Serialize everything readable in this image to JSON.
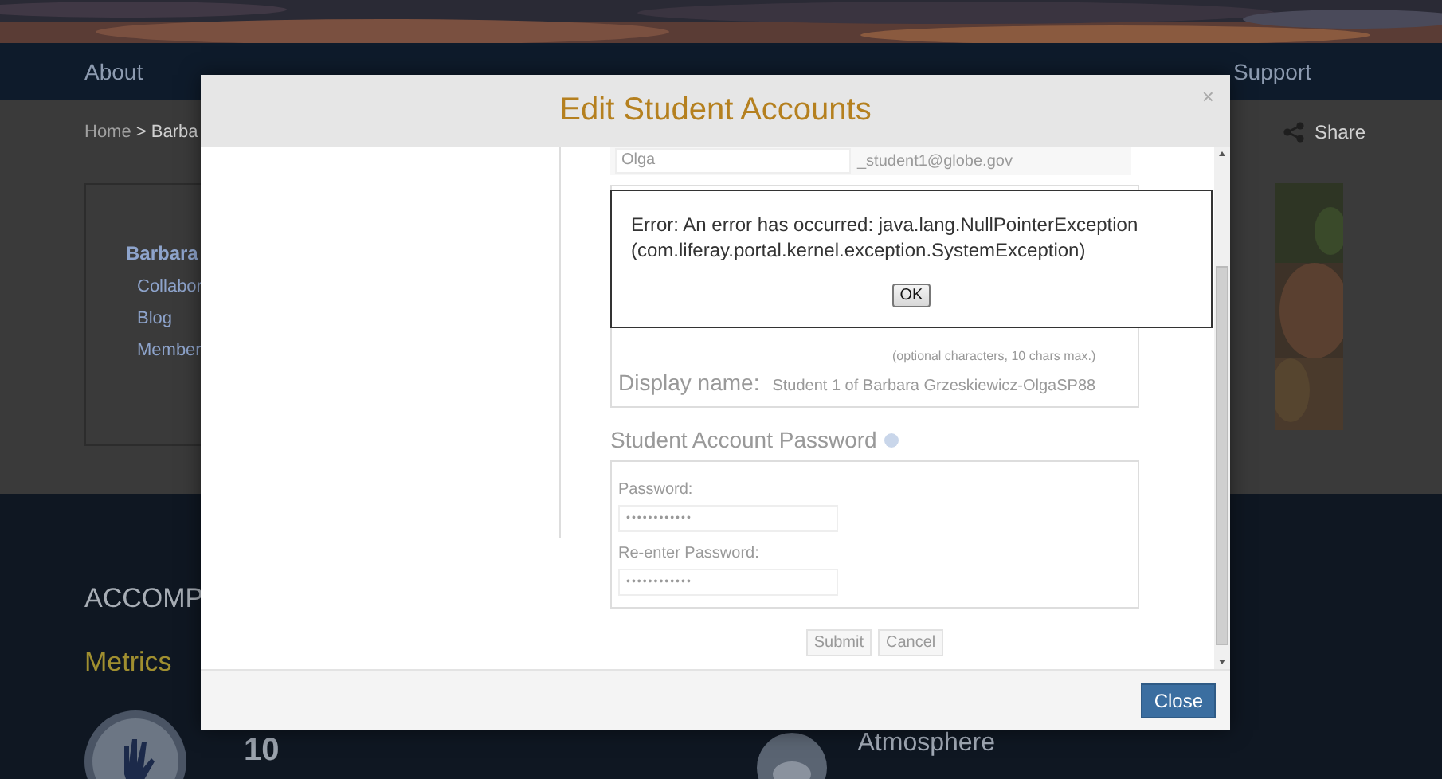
{
  "nav": {
    "items": [
      "About",
      "Support"
    ]
  },
  "breadcrumb": {
    "home": "Home",
    "separator": ">",
    "current": "Barba"
  },
  "share": {
    "label": "Share"
  },
  "sidebar": {
    "title": "Barbara",
    "links": [
      "Collabor",
      "Blog",
      "Member"
    ]
  },
  "accomplishments": {
    "heading": "ACCOMP",
    "metrics_heading": "Metrics",
    "count": "10",
    "category": "Atmosphere"
  },
  "modal": {
    "title": "Edit Student Accounts",
    "close": "×",
    "first_row": {
      "first_name": "Olga",
      "email": "_student1@globe.gov"
    },
    "student": {
      "hint": "(optional characters, 10 chars max.)",
      "display_label": "Display name:",
      "display_value": "Student 1 of Barbara Grzeskiewicz-OlgaSP88"
    },
    "password_section": {
      "title": "Student Account Password",
      "fields": [
        {
          "label": "Password:",
          "value": "••••••••••••"
        },
        {
          "label": "Re-enter Password:",
          "value": "••••••••••••"
        }
      ]
    },
    "buttons": [
      {
        "label": "Submit",
        "disabled": true
      },
      {
        "label": "Cancel",
        "disabled": true
      }
    ],
    "footer_button": "Close"
  },
  "error_dialog": {
    "message": "Error: An error has occurred: java.lang.NullPointerException (com.liferay.portal.kernel.exception.SystemException)",
    "button": "OK"
  }
}
